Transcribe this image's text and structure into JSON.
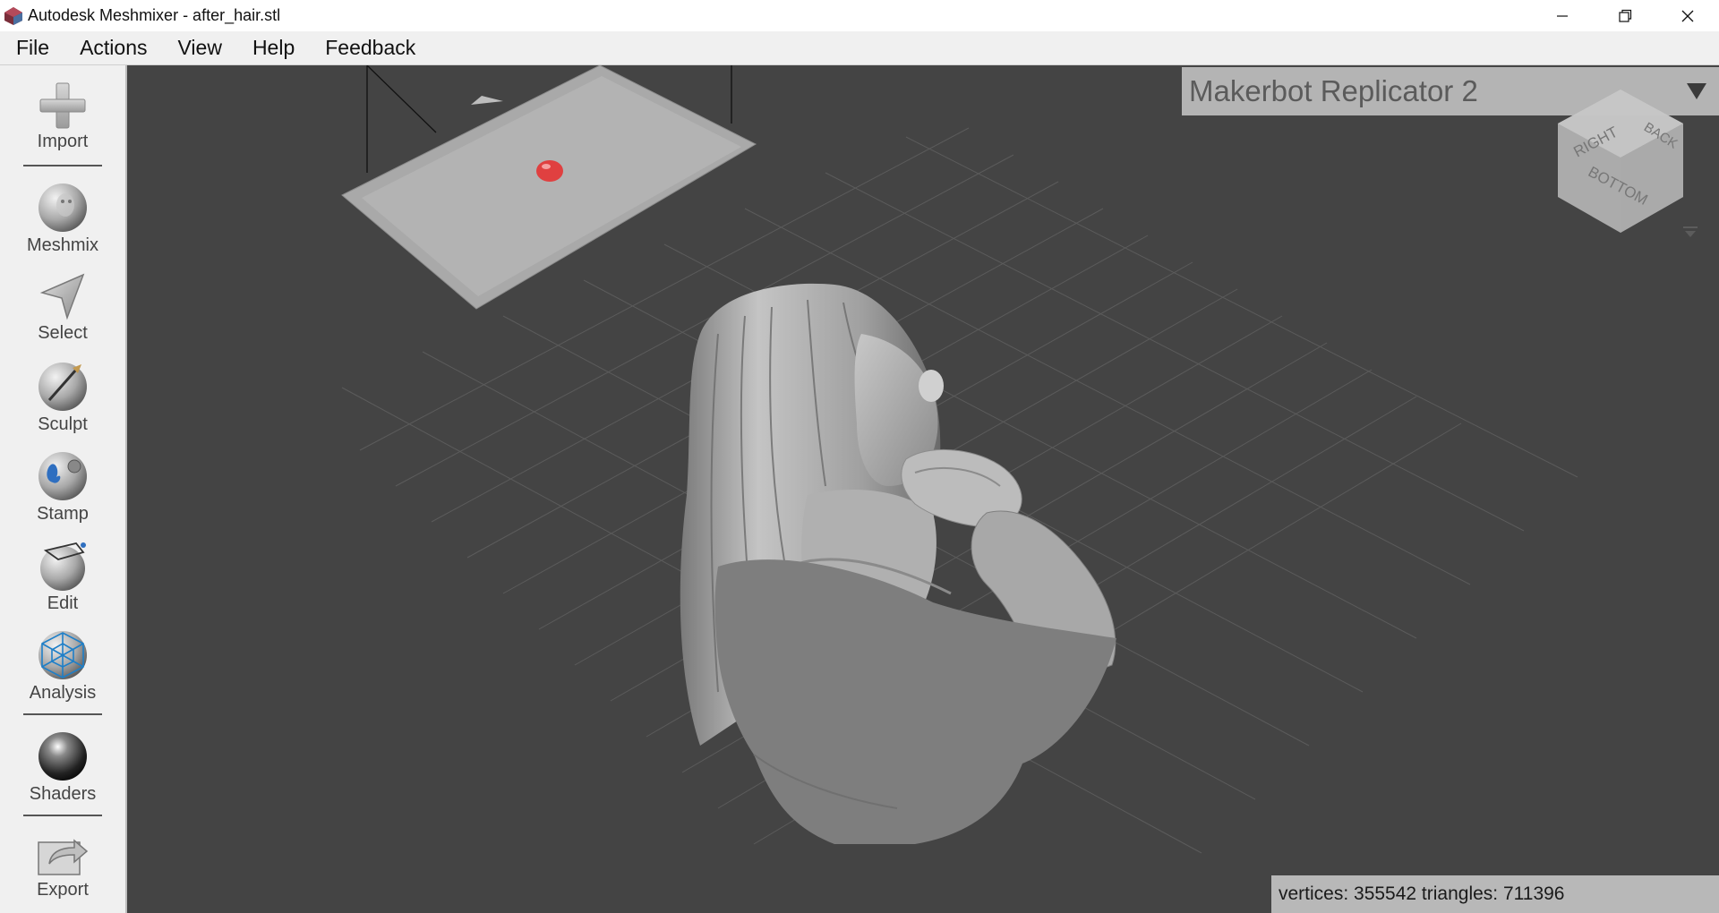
{
  "window": {
    "title": "Autodesk Meshmixer - after_hair.stl"
  },
  "menu": [
    "File",
    "Actions",
    "View",
    "Help",
    "Feedback"
  ],
  "tools": [
    {
      "label": "Import",
      "icon": "import-icon"
    },
    {
      "label": "Meshmix",
      "icon": "meshmix-icon"
    },
    {
      "label": "Select",
      "icon": "select-icon"
    },
    {
      "label": "Sculpt",
      "icon": "sculpt-icon"
    },
    {
      "label": "Stamp",
      "icon": "stamp-icon"
    },
    {
      "label": "Edit",
      "icon": "edit-icon"
    },
    {
      "label": "Analysis",
      "icon": "analysis-icon"
    },
    {
      "label": "Shaders",
      "icon": "shaders-icon"
    },
    {
      "label": "Export",
      "icon": "export-icon"
    }
  ],
  "printer": {
    "name": "Makerbot Replicator 2"
  },
  "viewcube": {
    "faces": [
      "RIGHT",
      "BACK",
      "BOTTOM"
    ]
  },
  "status": {
    "text": "vertices: 355542 triangles: 711396"
  },
  "colors": {
    "viewport_bg": "#444444",
    "toolbar_bg": "#f0f0f0",
    "mesh": "#9a9a9a",
    "marker": "#e04040"
  }
}
